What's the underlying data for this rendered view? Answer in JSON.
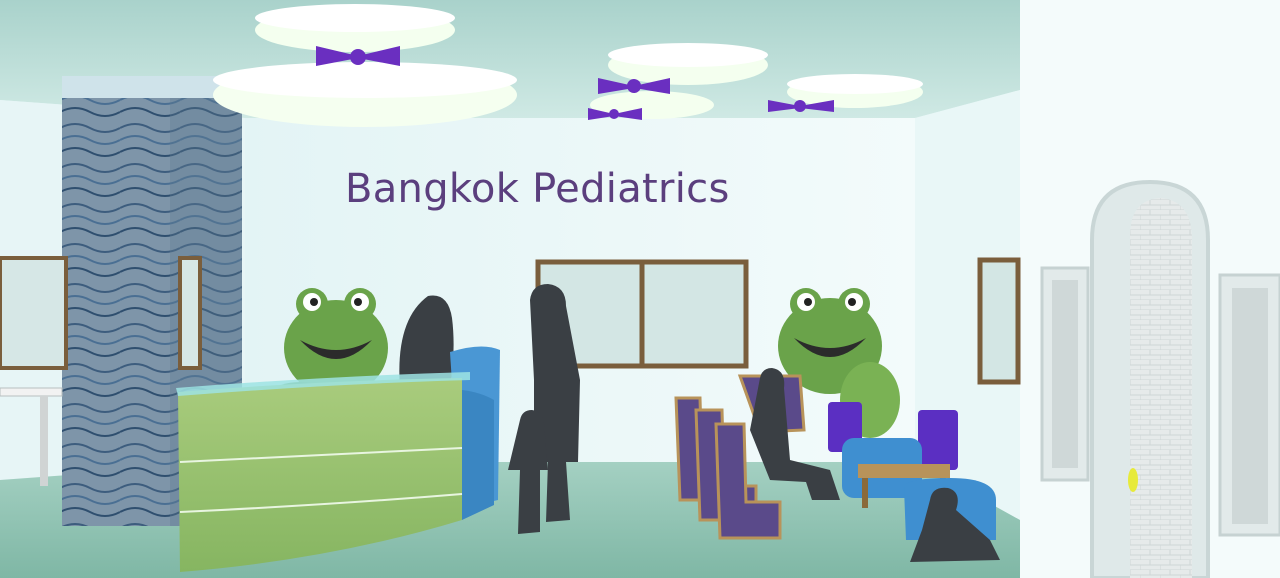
{
  "sign": {
    "text": "Bangkok Pediatrics"
  },
  "colors": {
    "wall": "#eef8f8",
    "ceiling": "#b9dcd6",
    "floor": "#8fc2b2",
    "sign_text": "#5b3f7e",
    "frog_green": "#6aa34a",
    "ribbon_purple": "#6a2fc0",
    "reception_green": "#9ac270",
    "reception_blue": "#3f8fd0",
    "chair_purple": "#5a4a8a",
    "silhouette": "#3a3f44"
  },
  "icons": [
    "frog-mascot",
    "ceiling-light",
    "ribbon-bow",
    "person-silhouette",
    "chair",
    "window",
    "arched-doorway"
  ]
}
